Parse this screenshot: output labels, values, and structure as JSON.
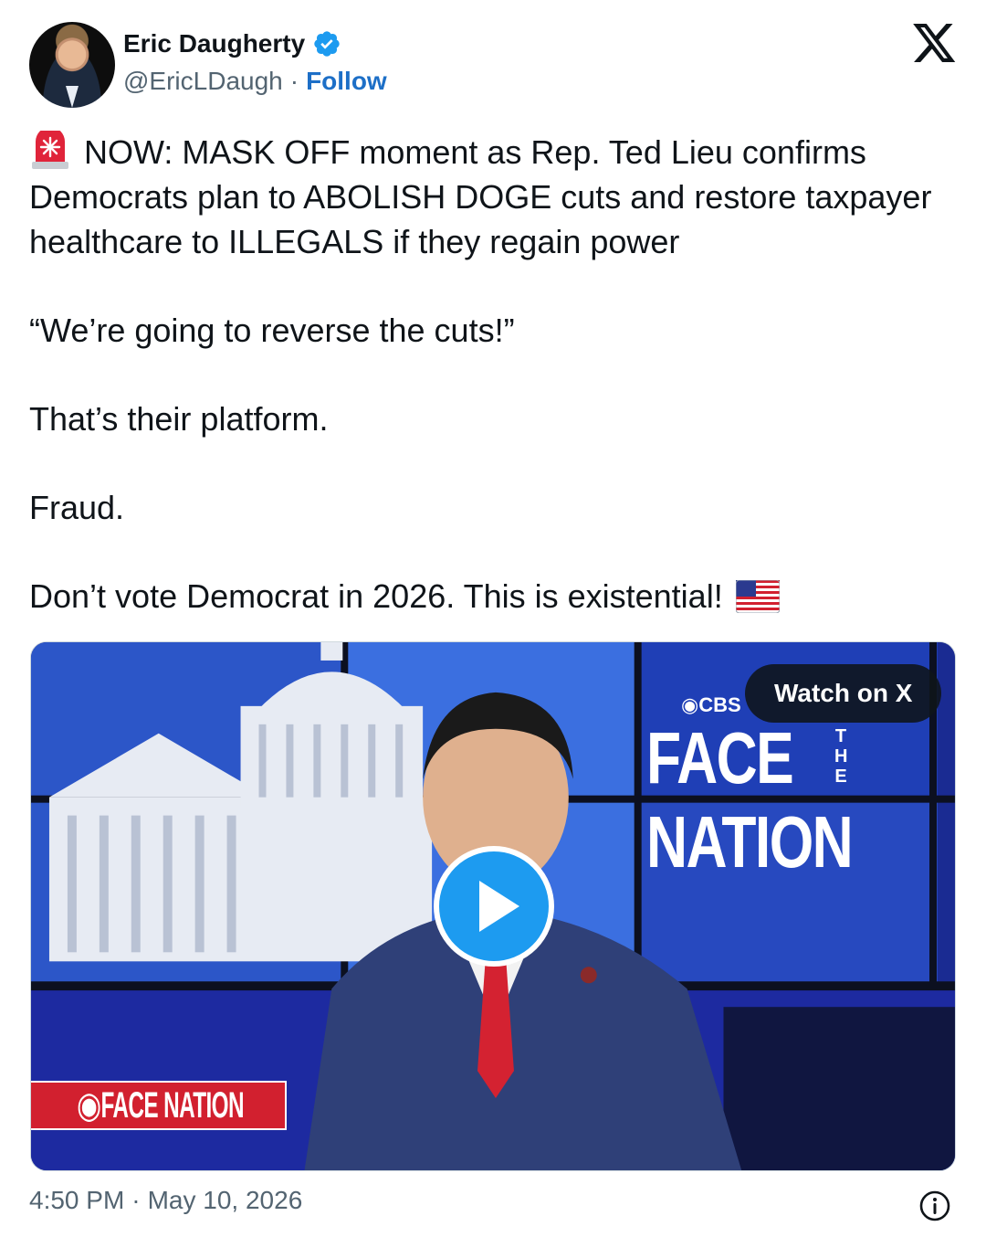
{
  "author": {
    "name": "Eric Daugherty",
    "handle": "@EricLDaugh",
    "separator": "·",
    "follow_label": "Follow",
    "verified_icon": "verified-badge-icon"
  },
  "platform_icon": "x-logo-icon",
  "tweet": {
    "line1": "NOW: MASK OFF moment as Rep. Ted Lieu confirms Democrats plan to ABOLISH DOGE cuts and restore taxpayer healthcare to ILLEGALS if they regain power",
    "line2": "“We’re going to reverse the cuts!”",
    "line3": "That’s their platform.",
    "line4": "Fraud.",
    "line5": "Don’t vote Democrat in 2026. This is existential!",
    "leading_emoji": "siren-icon",
    "trailing_emoji": "us-flag-icon"
  },
  "video": {
    "watch_label": "Watch on X",
    "play_icon": "play-icon",
    "overlay_network": "CBS",
    "overlay_show_line1": "FACE",
    "overlay_show_the": "THE",
    "overlay_show_line2": "NATION",
    "lower_third": "FACE NATION"
  },
  "footer": {
    "time": "4:50 PM",
    "separator": "·",
    "date": "May 10, 2026",
    "info_icon": "info-icon"
  },
  "colors": {
    "accent": "#1d9bf0",
    "follow": "#1d6fc7",
    "muted": "#536471",
    "cbs_red": "#d2202f"
  }
}
